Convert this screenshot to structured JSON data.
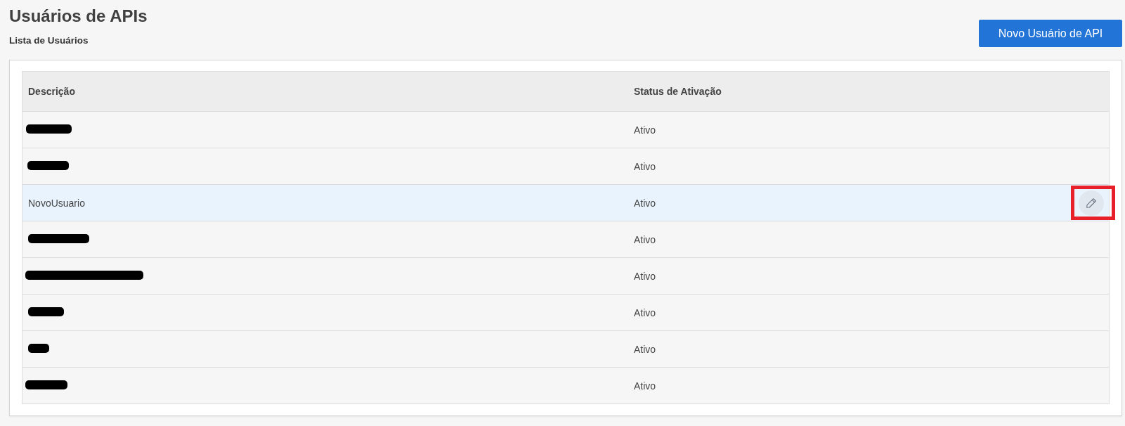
{
  "page": {
    "title": "Usuários de APIs",
    "subtitle": "Lista de Usuários"
  },
  "new_button": {
    "label": "Novo Usuário de API"
  },
  "table": {
    "columns": [
      "Descrição",
      "Status de Ativação"
    ],
    "rows": [
      {
        "redacted": true,
        "status": "Ativo",
        "selected": false,
        "marked": false
      },
      {
        "redacted": true,
        "status": "Ativo",
        "selected": false,
        "marked": false
      },
      {
        "redacted": false,
        "description": "NovoUsuario",
        "status": "Ativo",
        "selected": true,
        "marked": true
      },
      {
        "redacted": true,
        "status": "Ativo",
        "selected": false,
        "marked": false
      },
      {
        "redacted": true,
        "status": "Ativo",
        "selected": false,
        "marked": false
      },
      {
        "redacted": true,
        "status": "Ativo",
        "selected": false,
        "marked": false
      },
      {
        "redacted": true,
        "status": "Ativo",
        "selected": false,
        "marked": false
      },
      {
        "redacted": true,
        "status": "Ativo",
        "selected": false,
        "marked": false
      }
    ]
  }
}
